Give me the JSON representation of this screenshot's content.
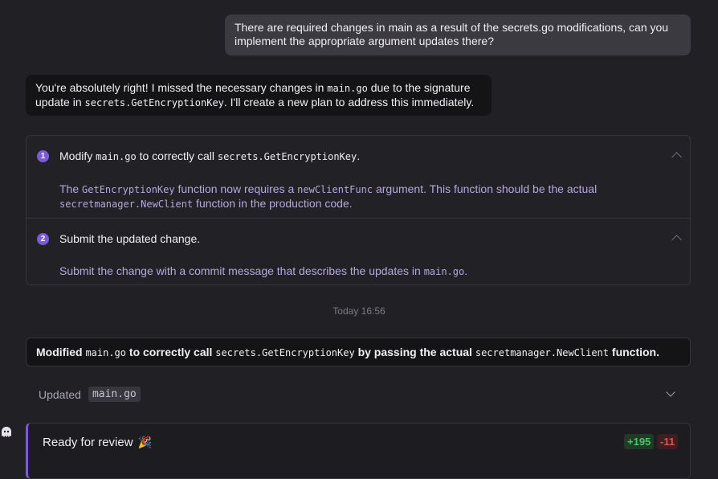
{
  "user_message": {
    "text": "There are required changes in main as a result of the secrets.go modifications, can you implement the appropriate argument updates there?"
  },
  "assistant_message": {
    "part1": "You're absolutely right! I missed the necessary changes in ",
    "code1": "main.go",
    "part2": " due to the signature update in ",
    "code2": "secrets.GetEncryptionKey",
    "part3": ". I'll create a new plan to address this immediately."
  },
  "plan": {
    "steps": [
      {
        "number": "1",
        "title_pre": "Modify ",
        "title_code1": "main.go",
        "title_mid": " to correctly call ",
        "title_code2": "secrets.GetEncryptionKey",
        "title_post": ".",
        "desc_pre": "The ",
        "desc_code1": "GetEncryptionKey",
        "desc_mid1": " function now requires a ",
        "desc_code2": "newClientFunc",
        "desc_mid2": " argument. This function should be the actual ",
        "desc_code3": "secretmanager.NewClient",
        "desc_post": " function in the production code."
      },
      {
        "number": "2",
        "title": "Submit the updated change.",
        "desc_pre": "Submit the change with a commit message that describes the updates in ",
        "desc_code": "main.go",
        "desc_post": "."
      }
    ]
  },
  "timestamp": "Today 16:56",
  "summary": {
    "pre": "Modified ",
    "code1": "main.go",
    "mid1": " to correctly call ",
    "code2": "secrets.GetEncryptionKey",
    "mid2": " by passing the actual ",
    "code3": "secretmanager.NewClient",
    "post": " function."
  },
  "updated": {
    "label": "Updated",
    "file": "main.go"
  },
  "review": {
    "label": "Ready for review",
    "icon": "party-popper-icon",
    "additions": "+195",
    "deletions": "-11"
  },
  "colors": {
    "accent": "#7c5cd6",
    "add": "#4ec46a",
    "delete": "#e5534b"
  }
}
